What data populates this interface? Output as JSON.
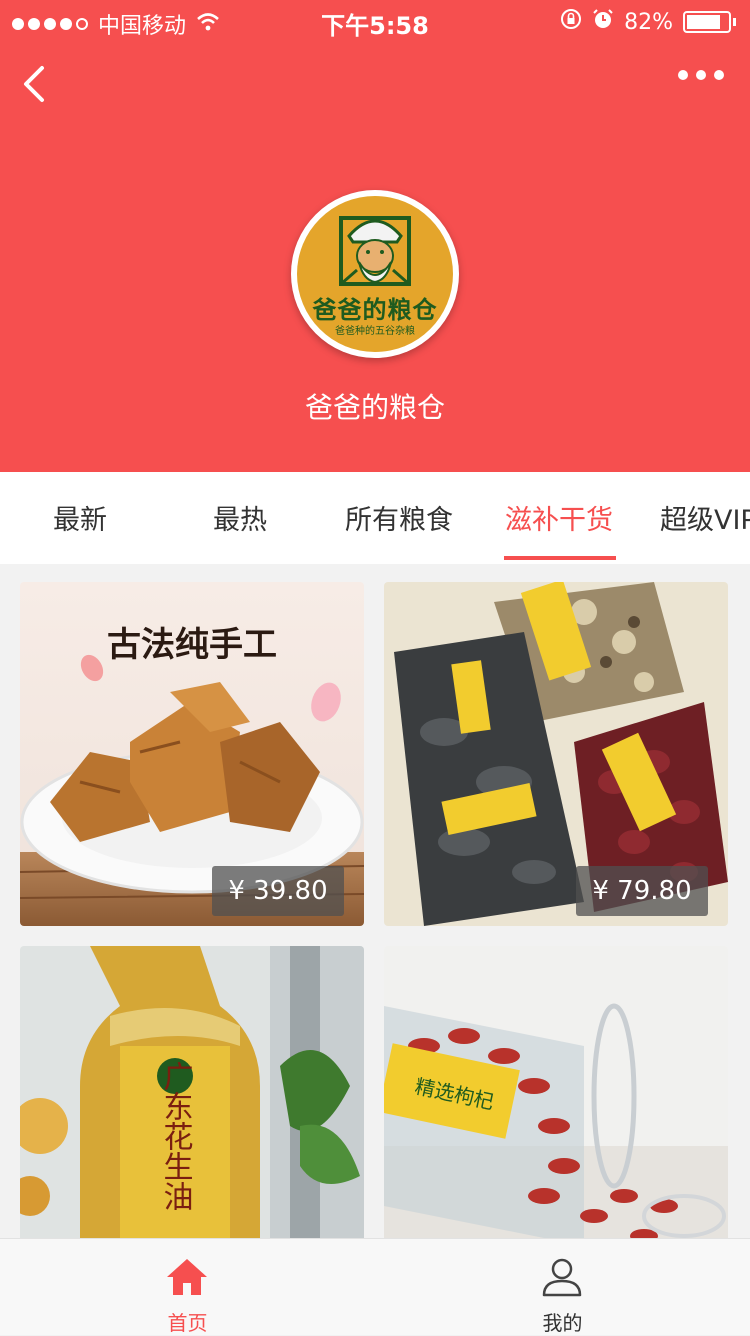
{
  "status_bar": {
    "carrier": "中国移动",
    "time": "下午5:58",
    "battery": "82%",
    "battery_level": 0.82,
    "signal_bars": 4,
    "icons": [
      "wifi-icon",
      "rotation-lock-icon",
      "alarm-icon",
      "battery-icon"
    ]
  },
  "header": {
    "background_color": "#f64f4f",
    "back_icon": "chevron-left-icon",
    "more_icon": "more-horizontal-icon",
    "logo": {
      "title": "爸爸的粮仓",
      "subtitle": "爸爸种的五谷杂粮",
      "background_color": "#e4a52b"
    },
    "shop_name": "爸爸的粮仓"
  },
  "tabs": {
    "items": [
      {
        "label": "最新"
      },
      {
        "label": "最热"
      },
      {
        "label": "所有粮食"
      },
      {
        "label": "滋补干货",
        "active": true
      },
      {
        "label": "超级VIP"
      }
    ],
    "active_color": "#f64f4f"
  },
  "products": [
    {
      "image_text": "古法纯手工",
      "price": "¥ 39.80",
      "image": "brown-sugar-photo"
    },
    {
      "price": "¥ 79.80",
      "image": "dried-mushrooms-jujube-photo"
    },
    {
      "image_text": "广东花生油",
      "price": "",
      "image": "peanut-oil-bottle-photo"
    },
    {
      "image_text": "精选枸杞",
      "price": "",
      "image": "goji-berry-jar-photo"
    }
  ],
  "tabbar": {
    "items": [
      {
        "label": "首页",
        "icon": "home-icon",
        "active": true
      },
      {
        "label": "我的",
        "icon": "user-icon",
        "active": false
      }
    ]
  }
}
